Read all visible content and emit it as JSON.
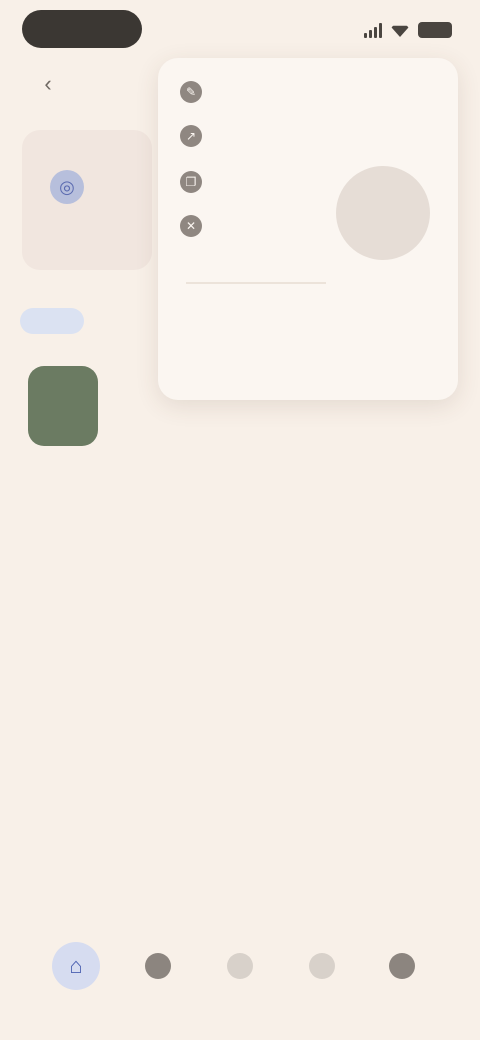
{
  "status_bar": {
    "pill_text": "",
    "icons": [
      "signal-icon",
      "wifi-icon",
      "battery-icon"
    ]
  },
  "header": {
    "back_icon": "‹"
  },
  "recipe_card": {
    "icon_glyph": "◎",
    "caption": ""
  },
  "link_chip": {
    "label": ""
  },
  "thumbnail": {
    "label": ""
  },
  "menu": {
    "items": [
      {
        "icon": "edit-icon",
        "label": ""
      },
      {
        "icon": "share-icon",
        "label": ""
      },
      {
        "icon": "copy-icon",
        "label": ""
      },
      {
        "icon": "delete-icon",
        "label": ""
      }
    ],
    "footer_text_1": "",
    "footer_text_2": ""
  },
  "bottom_nav": {
    "items": [
      {
        "icon": "home-icon",
        "active": true
      },
      {
        "icon": "search-icon",
        "active": false
      },
      {
        "icon": "add-icon",
        "active": false
      },
      {
        "icon": "bookmark-icon",
        "active": false
      },
      {
        "icon": "profile-icon",
        "active": false
      }
    ]
  },
  "colors": {
    "background": "#f8f0e8",
    "accent": "#4a5fb0",
    "accent_soft": "#d6dcf0",
    "surface": "#fbf6f1"
  }
}
